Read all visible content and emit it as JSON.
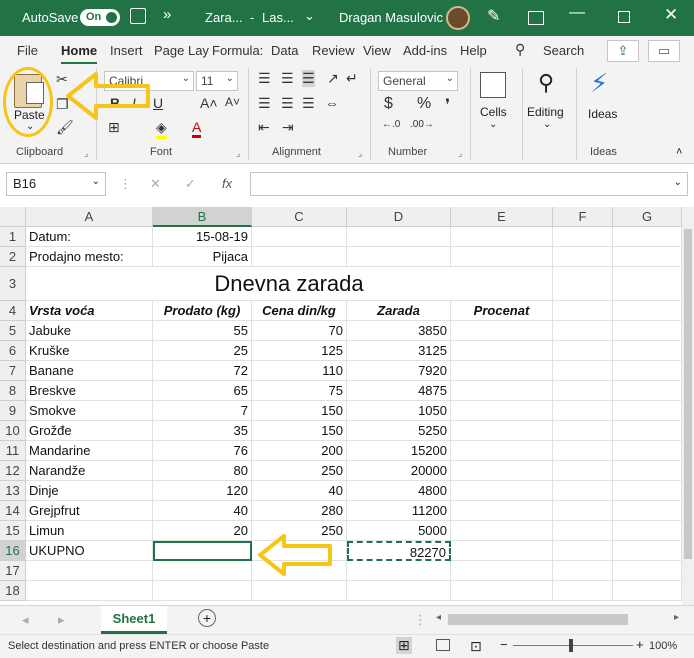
{
  "titlebar": {
    "autosave": "AutoSave",
    "toggle": "On",
    "filename": "Zara...",
    "dash": "-",
    "location": "Las...",
    "user": "Dragan Masulovic",
    "more": "»"
  },
  "tabs": [
    "File",
    "Home",
    "Insert",
    "Page Lay",
    "Formula:",
    "Data",
    "Review",
    "View",
    "Add-ins",
    "Help"
  ],
  "search": "Search",
  "ribbon": {
    "paste": "Paste",
    "font_name": "Calibri",
    "font_size": "11",
    "number_format": "General",
    "cells": "Cells",
    "editing": "Editing",
    "ideas": "Ideas",
    "groups": {
      "clipboard": "Clipboard",
      "font": "Font",
      "alignment": "Alignment",
      "number": "Number",
      "ideas": "Ideas"
    }
  },
  "formula_bar": {
    "name_box": "B16",
    "fx": "fx",
    "value": ""
  },
  "columns": [
    "A",
    "B",
    "C",
    "D",
    "E",
    "F",
    "G"
  ],
  "rows": [
    {
      "n": "1",
      "a": "Datum:",
      "b": "15-08-19",
      "c": "",
      "d": "",
      "e": ""
    },
    {
      "n": "2",
      "a": "Prodajno mesto:",
      "b": "Pijaca",
      "c": "",
      "d": "",
      "e": ""
    },
    {
      "n": "3",
      "title": "Dnevna zarada"
    },
    {
      "n": "4",
      "a": "Vrsta voća",
      "b": "Prodato (kg)",
      "c": "Cena din/kg",
      "d": "Zarada",
      "e": "Procenat"
    },
    {
      "n": "5",
      "a": "Jabuke",
      "b": "55",
      "c": "70",
      "d": "3850",
      "e": ""
    },
    {
      "n": "6",
      "a": "Kruške",
      "b": "25",
      "c": "125",
      "d": "3125",
      "e": ""
    },
    {
      "n": "7",
      "a": "Banane",
      "b": "72",
      "c": "110",
      "d": "7920",
      "e": ""
    },
    {
      "n": "8",
      "a": "Breskve",
      "b": "65",
      "c": "75",
      "d": "4875",
      "e": ""
    },
    {
      "n": "9",
      "a": "Smokve",
      "b": "7",
      "c": "150",
      "d": "1050",
      "e": ""
    },
    {
      "n": "10",
      "a": "Grožđe",
      "b": "35",
      "c": "150",
      "d": "5250",
      "e": ""
    },
    {
      "n": "11",
      "a": "Mandarine",
      "b": "76",
      "c": "200",
      "d": "15200",
      "e": ""
    },
    {
      "n": "12",
      "a": "Narandže",
      "b": "80",
      "c": "250",
      "d": "20000",
      "e": ""
    },
    {
      "n": "13",
      "a": "Dinje",
      "b": "120",
      "c": "40",
      "d": "4800",
      "e": ""
    },
    {
      "n": "14",
      "a": "Grejpfrut",
      "b": "40",
      "c": "280",
      "d": "11200",
      "e": ""
    },
    {
      "n": "15",
      "a": "Limun",
      "b": "20",
      "c": "250",
      "d": "5000",
      "e": ""
    },
    {
      "n": "16",
      "a": "UKUPNO",
      "b": "",
      "c": "",
      "d": "82270",
      "e": ""
    },
    {
      "n": "17",
      "a": "",
      "b": "",
      "c": "",
      "d": "",
      "e": ""
    },
    {
      "n": "18",
      "a": "",
      "b": "",
      "c": "",
      "d": "",
      "e": ""
    }
  ],
  "sheet_tab": "Sheet1",
  "status": "Select destination and press ENTER or choose Paste",
  "zoom": "100%",
  "colors": {
    "excel_green": "#217346",
    "highlight": "#f5c518"
  }
}
